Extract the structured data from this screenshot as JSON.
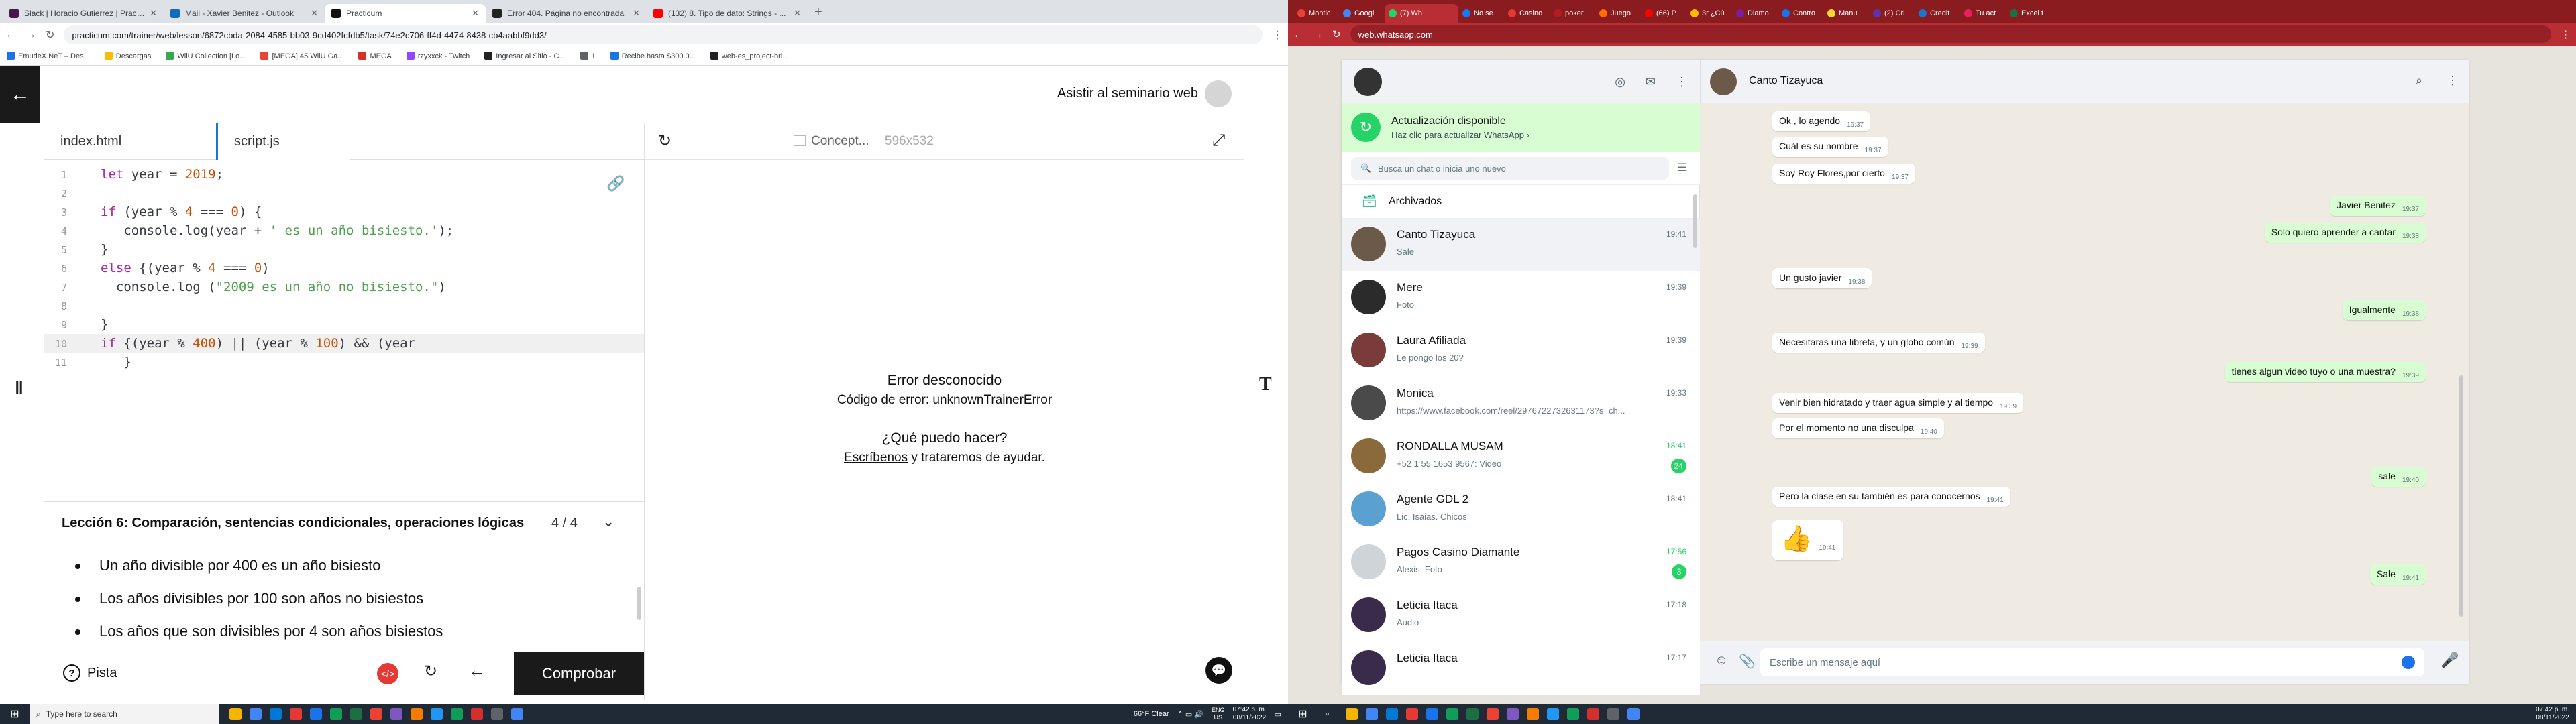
{
  "left_browser": {
    "tabs": [
      {
        "title": "Slack | Horacio Gutierrez | Practi...",
        "color": "#4a154b"
      },
      {
        "title": "Mail - Xavier Benitez - Outlook",
        "color": "#0f6cbd"
      },
      {
        "title": "Practicum",
        "color": "#111111"
      },
      {
        "title": "Error 404. Página no encontrada",
        "color": "#222222"
      },
      {
        "title": "(132) 8. Tipo de dato: Strings - ...",
        "color": "#ff0000"
      }
    ],
    "url": "practicum.com/trainer/web/lesson/6872cbda-2084-4585-bb03-9cd402fcfdb5/task/74e2c706-ff4d-4474-8438-cb4aabbf9dd3/",
    "bookmarks": [
      "EmudeX.NeT – Des...",
      "Descargas",
      "WiiU Collection [Lo...",
      "[MEGA] 45 WiiU Ga...",
      "MEGA",
      "rzyxxck - Twitch",
      "Ingresar al Sitio - C...",
      "1",
      "Recibe hasta $300.0...",
      "web-es_project-bri..."
    ]
  },
  "practicum": {
    "seminar": "Asistir al seminario web",
    "file_tabs": [
      "index.html",
      "script.js"
    ],
    "preview_tab": "Concept...",
    "preview_size": "596x532",
    "code_lines": [
      {
        "n": "1",
        "tokens": [
          [
            "kw",
            "let"
          ],
          [
            "tx",
            " year = "
          ],
          [
            "num",
            "2019"
          ],
          [
            "tx",
            ";"
          ]
        ]
      },
      {
        "n": "2",
        "tokens": []
      },
      {
        "n": "3",
        "tokens": [
          [
            "kw",
            "if"
          ],
          [
            "tx",
            " (year % "
          ],
          [
            "num",
            "4"
          ],
          [
            "tx",
            " === "
          ],
          [
            "num",
            "0"
          ],
          [
            "tx",
            ") {"
          ]
        ]
      },
      {
        "n": "4",
        "tokens": [
          [
            "tx",
            "   console.log(year + "
          ],
          [
            "str",
            "' es un año bisiesto.'"
          ],
          [
            "tx",
            ");"
          ]
        ]
      },
      {
        "n": "5",
        "tokens": [
          [
            "tx",
            "}"
          ]
        ]
      },
      {
        "n": "6",
        "tokens": [
          [
            "kw",
            "else"
          ],
          [
            "tx",
            " {(year % "
          ],
          [
            "num",
            "4"
          ],
          [
            "tx",
            " === "
          ],
          [
            "num",
            "0"
          ],
          [
            "tx",
            ")"
          ]
        ]
      },
      {
        "n": "7",
        "tokens": [
          [
            "tx",
            "  console.log ("
          ],
          [
            "str",
            "\"2009 es un año no bisiesto.\""
          ],
          [
            "tx",
            ")"
          ]
        ]
      },
      {
        "n": "8",
        "tokens": []
      },
      {
        "n": "9",
        "tokens": [
          [
            "tx",
            "}"
          ]
        ]
      },
      {
        "n": "10",
        "tokens": [
          [
            "kw",
            "if"
          ],
          [
            "tx",
            " {(year % "
          ],
          [
            "num",
            "400"
          ],
          [
            "tx",
            ") || (year % "
          ],
          [
            "num",
            "100"
          ],
          [
            "tx",
            ") && (year "
          ]
        ]
      },
      {
        "n": "11",
        "tokens": [
          [
            "tx",
            "   }"
          ]
        ]
      }
    ],
    "error_title": "Error desconocido",
    "error_code": "Código de error: unknownTrainerError",
    "error_question": "¿Qué puedo hacer?",
    "error_link": "Escríbenos",
    "error_rest": " y trataremos de ayudar.",
    "lesson_title": "Lección 6: Comparación, sentencias condicionales, operaciones lógicas",
    "lesson_progress": "4 / 4",
    "bullets": [
      "Un año divisible por 400 es un año bisiesto",
      "Los años divisibles por 100 son años no bisiestos",
      "Los años que son divisibles por 4 son años bisiestos"
    ],
    "hint": "Pista",
    "check": "Comprobar"
  },
  "right_browser": {
    "tabs": [
      "Montic",
      "Googl",
      "(7) Wh",
      "No se",
      "Casino",
      "poker",
      "Juego",
      "(66) P",
      "3r ¿Cú",
      "Diamo",
      "Contro",
      "Manu",
      "(2) Cri",
      "Credit",
      "Tu act",
      "Excel t"
    ],
    "url": "web.whatsapp.com"
  },
  "whatsapp": {
    "update_title": "Actualización disponible",
    "update_sub": "Haz clic para actualizar WhatsApp ›",
    "search_placeholder": "Busca un chat o inicia uno nuevo",
    "archived": "Archivados",
    "chats": [
      {
        "name": "Canto Tizayuca",
        "preview": "Sale",
        "time": "19:41",
        "color": "#6b5a4a"
      },
      {
        "name": "Mere",
        "preview": "Foto",
        "time": "19:39",
        "color": "#2b2b2b"
      },
      {
        "name": "Laura Afiliada",
        "preview": "Le pongo los 20?",
        "time": "19:39",
        "color": "#7a3b3b"
      },
      {
        "name": "Monica",
        "preview": "https://www.facebook.com/reel/2976722732631173?s=ch...",
        "time": "19:33",
        "color": "#4a4a4a"
      },
      {
        "name": "RONDALLA MUSAM",
        "preview": "+52 1 55 1653 9567: Video",
        "time": "18:41",
        "badge": "24",
        "color": "#8a6a3a"
      },
      {
        "name": "Agente GDL 2",
        "preview": "Lic. Isaias. Chicos",
        "time": "18:41",
        "color": "#5aa0d0"
      },
      {
        "name": "Pagos Casino Diamante",
        "preview": "Alexis: Foto",
        "time": "17:56",
        "badge": "3",
        "color": "#cfd4d8"
      },
      {
        "name": "Leticia Itaca",
        "preview": "Audio",
        "time": "17:18",
        "color": "#3b2b4b"
      },
      {
        "name": "Leticia Itaca",
        "preview": "",
        "time": "17:17",
        "color": "#3b2b4b"
      }
    ],
    "contact": "Canto Tizayuca",
    "messages": [
      {
        "dir": "in",
        "text": "Ok , lo agendo",
        "time": "19:37"
      },
      {
        "dir": "in",
        "text": "Cuál es su nombre",
        "time": "19:37"
      },
      {
        "dir": "in",
        "text": "Soy Roy Flores,por cierto",
        "time": "19:37"
      },
      {
        "dir": "out",
        "text": "Javier Benitez",
        "time": "19:37"
      },
      {
        "dir": "out",
        "text": "Solo quiero aprender a cantar",
        "time": "19:38"
      },
      {
        "dir": "in",
        "text": "Un gusto javier",
        "time": "19:38"
      },
      {
        "dir": "out",
        "text": "Igualmente",
        "time": "19:38"
      },
      {
        "dir": "in",
        "text": "Necesitaras una libreta, y un globo común",
        "time": "19:39"
      },
      {
        "dir": "out",
        "text": "tienes algun video tuyo o una muestra?",
        "time": "19:39"
      },
      {
        "dir": "in",
        "text": "Venir bien hidratado y traer agua simple y al tiempo",
        "time": "19:39"
      },
      {
        "dir": "in",
        "text": "Por el momento no una disculpa",
        "time": "19:40"
      },
      {
        "dir": "out",
        "text": "sale",
        "time": "19:40"
      },
      {
        "dir": "in",
        "text": "Pero la clase en su también es para conocernos",
        "time": "19:41"
      },
      {
        "dir": "in",
        "text": "👍",
        "time": "19:41"
      },
      {
        "dir": "out",
        "text": "Sale",
        "time": "19:41"
      }
    ],
    "input_placeholder": "Escribe un mensaje aquí"
  },
  "taskbar": {
    "search": "Type here to search",
    "weather": "66°F  Clear",
    "lang": "ENG",
    "region": "US",
    "time": "07:42 p. m.",
    "date": "08/11/2022"
  }
}
